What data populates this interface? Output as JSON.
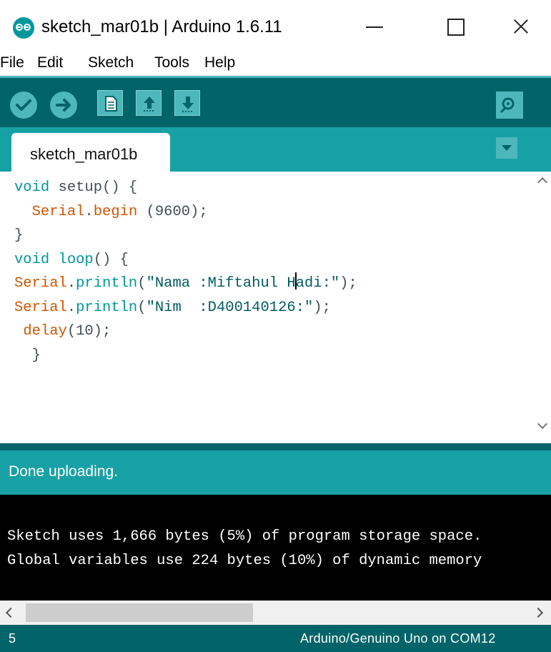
{
  "window": {
    "title": "sketch_mar01b | Arduino 1.6.11",
    "app_icon": "arduino-logo-icon",
    "controls": [
      "minimize-icon",
      "maximize-icon",
      "close-icon"
    ]
  },
  "menu": {
    "items": [
      "File",
      "Edit",
      "Sketch",
      "Tools",
      "Help"
    ]
  },
  "toolbar": {
    "buttons": [
      "verify-icon",
      "upload-icon",
      "new-sketch-icon",
      "open-sketch-icon",
      "save-sketch-icon"
    ],
    "serial_monitor_icon": "serial-monitor-icon"
  },
  "tabs": {
    "active": "sketch_mar01b",
    "menu_icon": "tab-dropdown-icon"
  },
  "editor": {
    "lines": [
      "void setup() {",
      "  Serial.begin (9600);",
      "}",
      "void loop() {",
      "Serial.println(\"Nama :Miftahul Hadi:\");",
      "Serial.println(\"Nim  :D400140126:\");",
      " delay(10);",
      "  }"
    ]
  },
  "status": {
    "message": "Done uploading."
  },
  "console": {
    "lines": [
      "Sketch uses 1,666 bytes (5%) of program storage space.",
      "Global variables use 224 bytes (10%) of dynamic memory"
    ]
  },
  "footer": {
    "line_number": "5",
    "board": "Arduino/Genuino Uno on COM12"
  },
  "colors": {
    "toolbar_bg": "#006468",
    "tabbar_bg": "#17a1a5",
    "button_bg": "#4db7bb",
    "keyword": "#00979c",
    "function": "#d35400",
    "console_bg": "#000000"
  }
}
